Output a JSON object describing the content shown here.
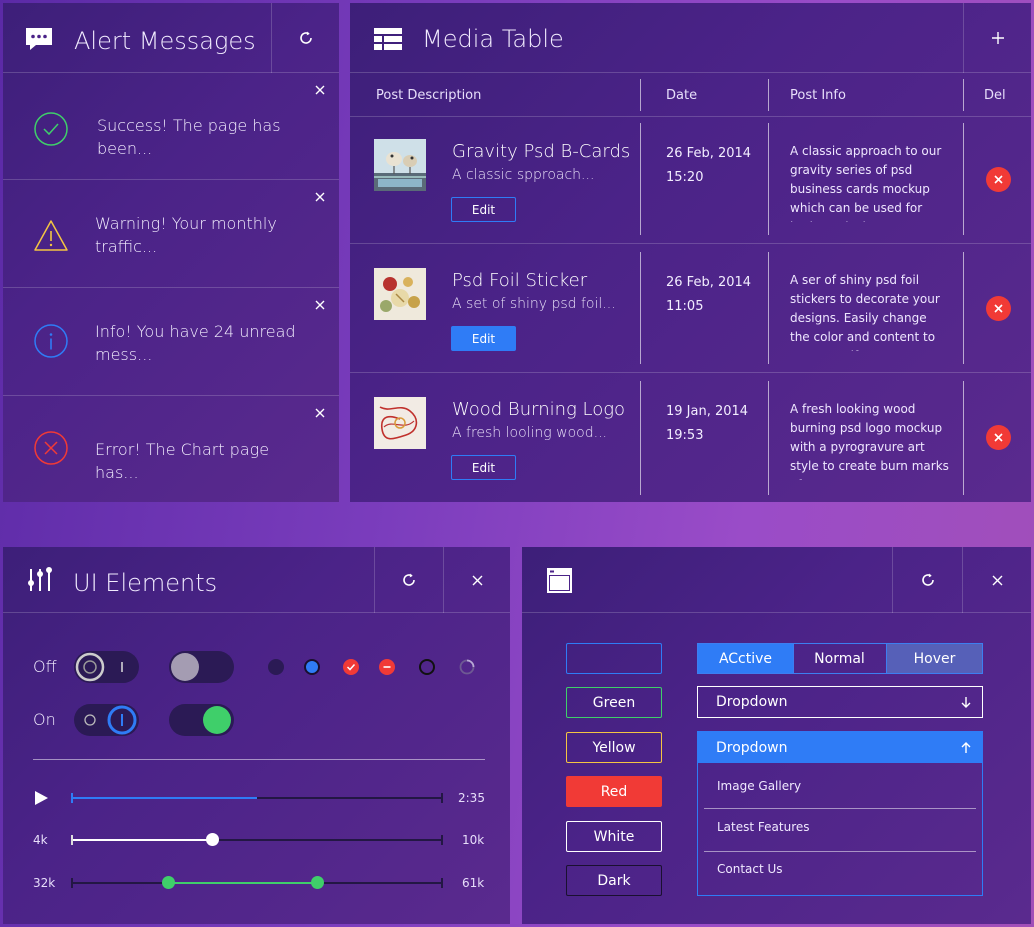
{
  "alerts_panel": {
    "title": "Alert Messages",
    "messages": [
      {
        "type": "success",
        "icon": "check-circle-icon",
        "color": "#3fcf6a",
        "text": "Success! The page has been..."
      },
      {
        "type": "warning",
        "icon": "warning-triangle-icon",
        "color": "#f4c542",
        "text": "Warning! Your monthly traffic..."
      },
      {
        "type": "info",
        "icon": "info-circle-icon",
        "color": "#2f7cf6",
        "text": "Info! You have 24 unread mess..."
      },
      {
        "type": "error",
        "icon": "x-circle-icon",
        "color": "#f13a36",
        "text": "Error! The Chart page has..."
      }
    ]
  },
  "media_table": {
    "title": "Media Table",
    "columns": [
      "Post Description",
      "Date",
      "Post Info",
      "Del"
    ],
    "rows": [
      {
        "title": "Gravity Psd B-Cards",
        "subtitle": "A classic spproach...",
        "edit_label": "Edit",
        "edit_style": "outline",
        "date": "26 Feb, 2014",
        "time": "15:20",
        "info": "A classic approach to our gravity series of psd business cards mockup which can be used for both vertical"
      },
      {
        "title": "Psd Foil Sticker",
        "subtitle": "A set of shiny psd foil...",
        "edit_label": "Edit",
        "edit_style": "filled",
        "date": "26 Feb, 2014",
        "time": "11:05",
        "info": "A ser of shiny psd foil stickers to decorate your designs. Easily change the color and content to create a nifty..."
      },
      {
        "title": "Wood Burning Logo",
        "subtitle": "A fresh looling wood...",
        "edit_label": "Edit",
        "edit_style": "outline",
        "date": "19 Jan, 2014",
        "time": "19:53",
        "info": "A fresh looking wood burning psd logo mockup with a pyrogravure art style to create burn marks of your"
      }
    ]
  },
  "ui_elements": {
    "title": "UI Elements",
    "off_label": "Off",
    "on_label": "On",
    "player": {
      "time": "2:35",
      "progress": 0.5
    },
    "slider_single": {
      "min_label": "4k",
      "max_label": "10k",
      "value_fraction": 0.38
    },
    "slider_range": {
      "min_label": "32k",
      "max_label": "61k",
      "low_fraction": 0.26,
      "high_fraction": 0.66
    }
  },
  "right_panel": {
    "buttons": [
      {
        "label": "",
        "border": "#2f7cf6",
        "bg": "transparent"
      },
      {
        "label": "Green",
        "border": "#3fcf6a",
        "bg": "transparent"
      },
      {
        "label": "Yellow",
        "border": "#f4c542",
        "bg": "transparent"
      },
      {
        "label": "Red",
        "border": "#f13a36",
        "bg": "#f13a36"
      },
      {
        "label": "White",
        "border": "#ffffff",
        "bg": "transparent"
      },
      {
        "label": "Dark",
        "border": "#1a1030",
        "bg": "transparent"
      }
    ],
    "segments": [
      "ACctive",
      "Normal",
      "Hover"
    ],
    "dropdown_closed": "Dropdown",
    "dropdown_open": "Dropdown",
    "dropdown_items": [
      "Image Gallery",
      "Latest Features",
      "Contact Us"
    ]
  },
  "colors": {
    "accent": "#2f7cf6",
    "danger": "#f13a36",
    "success": "#3fcf6a",
    "warning": "#f4c542"
  }
}
